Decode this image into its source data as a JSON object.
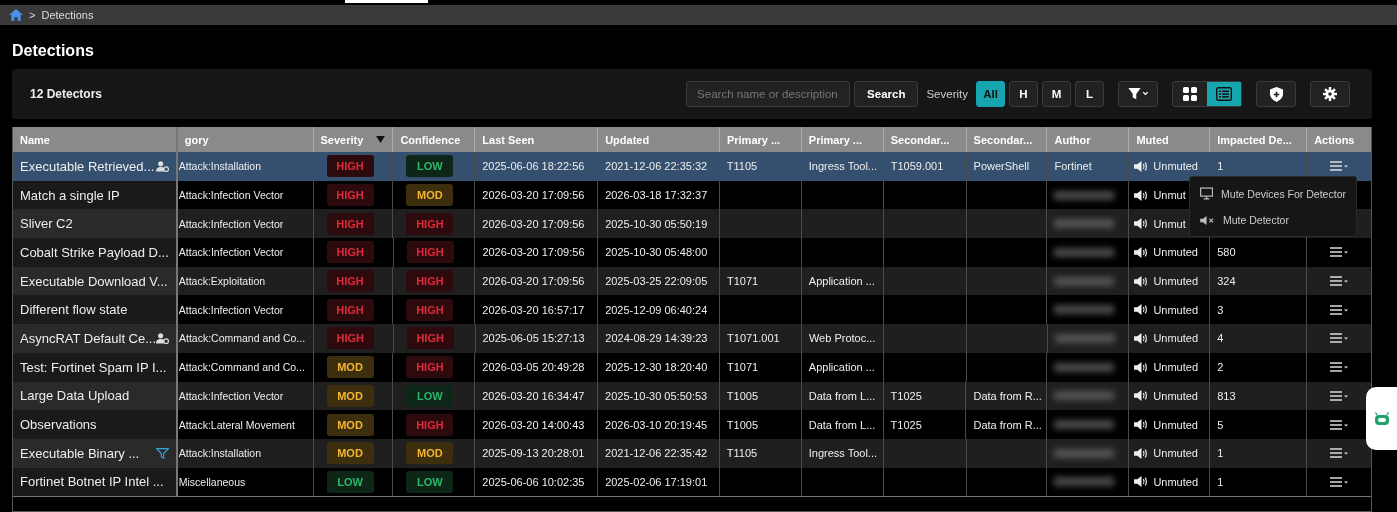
{
  "breadcrumb": {
    "separator": ">",
    "items": [
      "Detections"
    ]
  },
  "page_title": "Detections",
  "toolbar": {
    "count": "12 Detectors",
    "search": {
      "placeholder": "Search name or description",
      "button": "Search"
    },
    "severity_label": "Severity",
    "severity_filters": [
      {
        "label": "All",
        "selected": true
      },
      {
        "label": "H",
        "selected": false
      },
      {
        "label": "M",
        "selected": false
      },
      {
        "label": "L",
        "selected": false
      }
    ],
    "views": [
      {
        "kind": "grid",
        "selected": false
      },
      {
        "kind": "list",
        "selected": true
      }
    ]
  },
  "table": {
    "columns": [
      "Name",
      "gory",
      "Severity",
      "Confidence",
      "Last Seen",
      "Updated",
      "Primary ...",
      "Primary ...",
      "Secondar...",
      "Secondar...",
      "Author",
      "Muted",
      "Impacted De...",
      "Actions"
    ],
    "rows": [
      {
        "name": "Executable Retrieved...",
        "kind": "shared",
        "category": "Attack:Installation",
        "severity": "HIGH",
        "confidence": "LOW",
        "last_seen": "2025-06-06 18:22:56",
        "updated": "2021-12-06 22:35:32",
        "primary_1": "T1105",
        "primary_2": "Ingress Tool...",
        "secondary_1": "T1059.001",
        "secondary_2": "PowerShell",
        "author": "Fortinet",
        "muted": "Unmuted",
        "impacted": "1",
        "selected": true,
        "menu": [
          "Mute Devices For Detector",
          "Mute Detector"
        ]
      },
      {
        "name": "Match a single IP",
        "category": "Attack:Infection Vector",
        "severity": "HIGH",
        "confidence": "MOD",
        "last_seen": "2026-03-20 17:09:56",
        "updated": "2026-03-18 17:32:37",
        "author_blurred": true,
        "muted": "Unmut",
        "selected": false
      },
      {
        "name": "Sliver C2",
        "category": "Attack:Infection Vector",
        "severity": "HIGH",
        "confidence": "HIGH",
        "last_seen": "2026-03-20 17:09:56",
        "updated": "2025-10-30 05:50:19",
        "author_blurred": true,
        "muted": "Unmut",
        "selected": false
      },
      {
        "name": "Cobalt Strike Payload D...",
        "category": "Attack:Infection Vector",
        "severity": "HIGH",
        "confidence": "HIGH",
        "last_seen": "2026-03-20 17:09:56",
        "updated": "2025-10-30 05:48:00",
        "author_blurred": true,
        "muted": "Unmuted",
        "impacted": "580",
        "selected": false
      },
      {
        "name": "Executable Download V...",
        "category": "Attack:Exploitation",
        "severity": "HIGH",
        "confidence": "HIGH",
        "last_seen": "2026-03-20 17:09:56",
        "updated": "2025-03-25 22:09:05",
        "primary_1": "T1071",
        "primary_2": "Application ...",
        "author_blurred": true,
        "muted": "Unmuted",
        "impacted": "324",
        "selected": false
      },
      {
        "name": "Different flow state",
        "category": "Attack:Infection Vector",
        "severity": "HIGH",
        "confidence": "HIGH",
        "last_seen": "2026-03-20 16:57:17",
        "updated": "2025-12-09 06:40:24",
        "author_blurred": true,
        "muted": "Unmuted",
        "impacted": "3",
        "selected": false
      },
      {
        "name": "AsyncRAT Default Ce...",
        "kind": "shared",
        "category": "Attack:Command and Co...",
        "severity": "HIGH",
        "confidence": "HIGH",
        "last_seen": "2025-06-05 15:27:13",
        "updated": "2024-08-29 14:39:23",
        "primary_1": "T1071.001",
        "primary_2": "Web Protoc...",
        "author_blurred": true,
        "muted": "Unmuted",
        "impacted": "4",
        "selected": false
      },
      {
        "name": "Test: Fortinet Spam IP I...",
        "category": "Attack:Command and Co...",
        "severity": "MOD",
        "confidence": "HIGH",
        "last_seen": "2026-03-05 20:49:28",
        "updated": "2025-12-30 18:20:40",
        "primary_1": "T1071",
        "primary_2": "Application ...",
        "author_blurred": true,
        "muted": "Unmuted",
        "impacted": "2",
        "selected": false
      },
      {
        "name": "Large Data Upload",
        "category": "Attack:Infection Vector",
        "severity": "MOD",
        "confidence": "LOW",
        "last_seen": "2026-03-20 16:34:47",
        "updated": "2025-10-30 05:50:53",
        "primary_1": "T1005",
        "primary_2": "Data from L...",
        "secondary_1": "T1025",
        "secondary_2": "Data from R...",
        "author_blurred": true,
        "muted": "Unmuted",
        "impacted": "813",
        "selected": false
      },
      {
        "name": "Observations",
        "category": "Attack:Lateral Movement",
        "severity": "MOD",
        "confidence": "HIGH",
        "last_seen": "2026-03-20 14:00:43",
        "updated": "2026-03-10 20:19:45",
        "primary_1": "T1005",
        "primary_2": "Data from L...",
        "secondary_1": "T1025",
        "secondary_2": "Data from R...",
        "author_blurred": true,
        "muted": "Unmuted",
        "impacted": "5",
        "selected": false
      },
      {
        "name": "Executable Binary ...",
        "kind": "filtered",
        "category": "Attack:Installation",
        "severity": "MOD",
        "confidence": "MOD",
        "last_seen": "2025-09-13 20:28:01",
        "updated": "2021-12-06 22:35:42",
        "primary_1": "T1105",
        "primary_2": "Ingress Tool...",
        "author_blurred": true,
        "muted": "Unmuted",
        "impacted": "1",
        "selected": false
      },
      {
        "name": "Fortinet Botnet IP Intel ...",
        "category": "Miscellaneous",
        "severity": "LOW",
        "confidence": "LOW",
        "last_seen": "2025-06-06 10:02:35",
        "updated": "2025-02-06 17:19:01",
        "author_blurred": true,
        "muted": "Unmuted",
        "impacted": "1",
        "selected": false
      }
    ]
  }
}
